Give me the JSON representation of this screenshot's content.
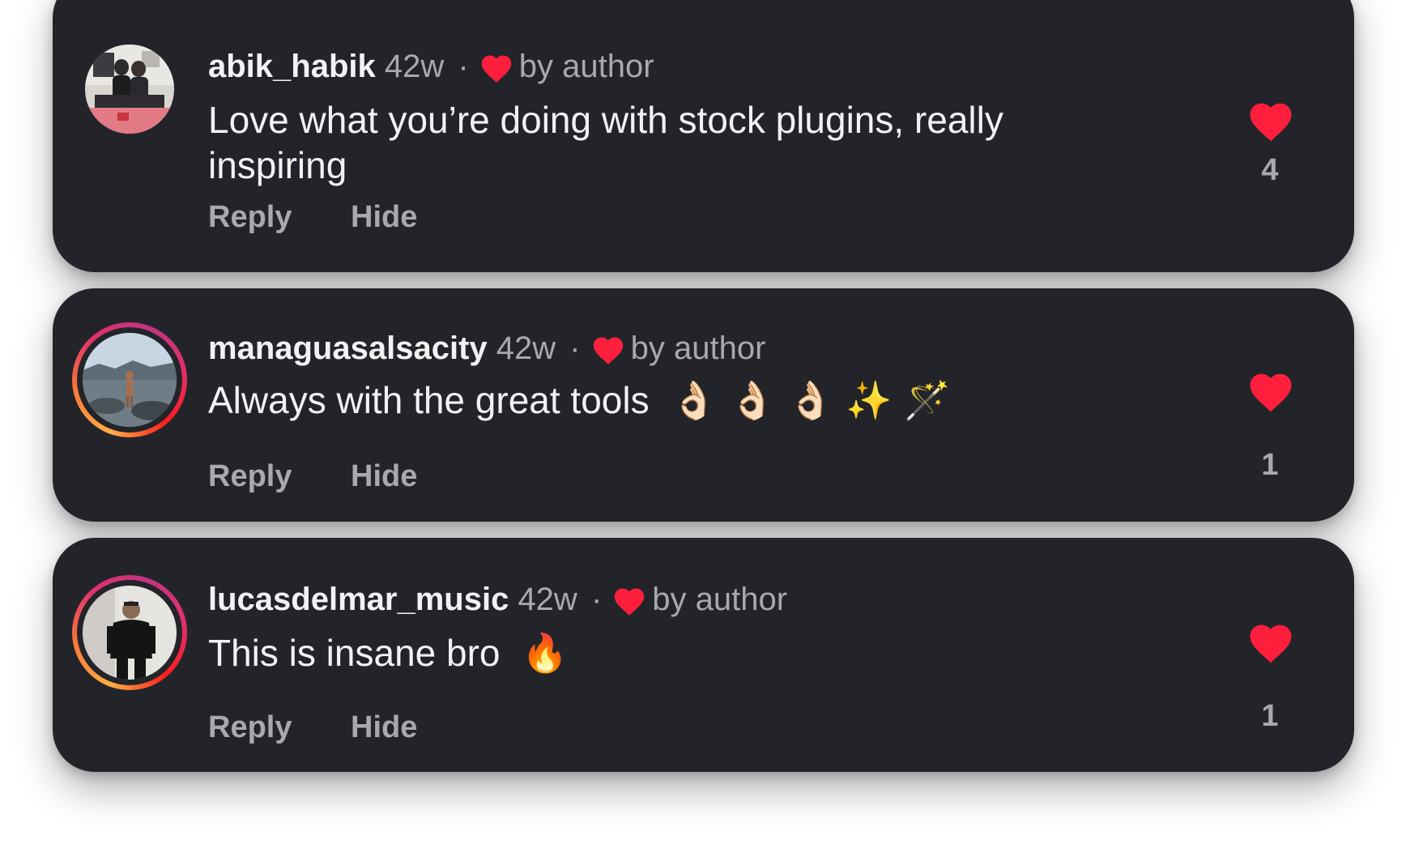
{
  "colors": {
    "card_background": "#232429",
    "page_background": "#ffffff",
    "heart": "#ff1f3d",
    "primary_text": "#f2f2f4",
    "secondary_text": "#a8a9ae"
  },
  "comments": [
    {
      "username": "abik_habik",
      "age": "42w",
      "separator": "·",
      "liked_by_author_label": "by author",
      "text": "Love what you’re doing with stock plugins, really inspiring",
      "emojis": "",
      "reply_label": "Reply",
      "hide_label": "Hide",
      "like_count": "4",
      "has_story_ring": false,
      "icons": {
        "author_like": "heart-icon",
        "like": "heart-icon",
        "avatar": "profile-photo"
      }
    },
    {
      "username": "managuasalsacity",
      "age": "42w",
      "separator": "·",
      "liked_by_author_label": "by author",
      "text": "Always with the great tools",
      "emojis": "👌🏻 👌🏻 👌🏻 ✨ 🪄",
      "reply_label": "Reply",
      "hide_label": "Hide",
      "like_count": "1",
      "has_story_ring": true,
      "icons": {
        "author_like": "heart-icon",
        "like": "heart-icon",
        "avatar": "profile-photo"
      }
    },
    {
      "username": "lucasdelmar_music",
      "age": "42w",
      "separator": "·",
      "liked_by_author_label": "by author",
      "text": "This is insane bro",
      "emojis": "🔥",
      "reply_label": "Reply",
      "hide_label": "Hide",
      "like_count": "1",
      "has_story_ring": true,
      "icons": {
        "author_like": "heart-icon",
        "like": "heart-icon",
        "avatar": "profile-photo"
      }
    }
  ]
}
